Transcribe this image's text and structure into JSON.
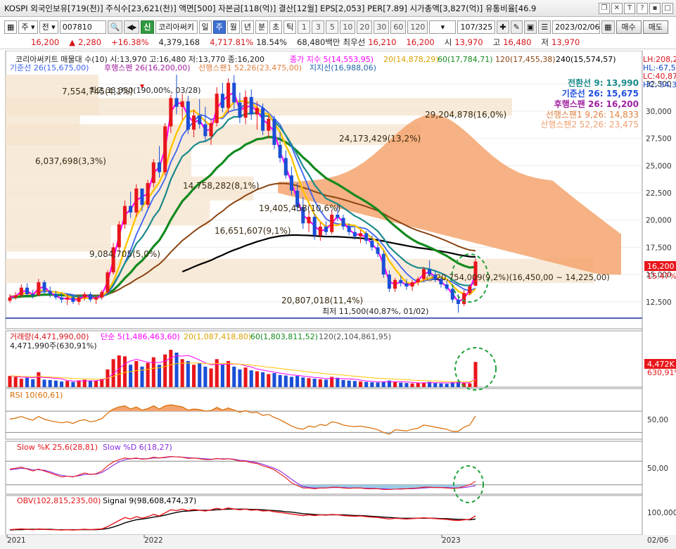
{
  "window": {
    "title": "KOSPI 외국인보유[719(천)] 주식수[23,621(천)] 액면[500] 자본금[118(억)] 결산[12월] EPS[2,053] PER[7.89] 시가총액[3,827(억)] 유통비율[46.9",
    "icons": [
      "restore-icon",
      "close-icon"
    ],
    "icon_glyphs": [
      "T",
      "?",
      "▪",
      "□"
    ]
  },
  "toolbar": {
    "period_select": "주",
    "adj_select": "전",
    "code": "007810",
    "stock_badge": "신",
    "stock_name": "코리아써키",
    "timeframes": [
      "일",
      "주",
      "월",
      "년",
      "분",
      "초",
      "틱"
    ],
    "active_timeframe": "주",
    "intervals": [
      "1",
      "3",
      "5",
      "10",
      "20",
      "30",
      "60",
      "120"
    ],
    "page_count": "107/325",
    "date": "2023/02/06",
    "buy_label": "매수",
    "sell_label": "매도"
  },
  "price_row": {
    "price": "16,200",
    "change_arrow": "▲",
    "change": "2,280",
    "change_rate": "+16.38%",
    "volume": "4,379,168",
    "volume_rate": "4,717.81%",
    "turnover": "18.54%",
    "amount": "68,480백만",
    "priority_label": "최우선",
    "priority": "16,210",
    "bid": "16,200",
    "open_label": "시",
    "open": "13,970",
    "high_label": "고",
    "high": "16,480",
    "low_label": "저",
    "low": "13,970"
  },
  "price_panel": {
    "header": "코리아써키트 매물대 수(10)   시:13,970 고:16,480 저:13,770 종:16,200",
    "ma_legend": [
      {
        "label": "종가 지수 5(14,553,95)",
        "color": "#ff00ff"
      },
      {
        "label": "20(14,878,29)",
        "color": "#ffc400"
      },
      {
        "label": "60(17,784,71)",
        "color": "#138a1e"
      },
      {
        "label": "120(17,455,38)",
        "color": "#8b4513"
      },
      {
        "label": "240(15,574,57)",
        "color": "#000000"
      }
    ],
    "ichimoku_row2": "기준선 26(15,675,00)",
    "ichimoku_row2b": "후행스팬 26(16,200,00)",
    "ichimoku_row2c": "선행스팬1 52,26(23,475,00)",
    "ichimoku_row2d": "지지선(16,988,06)",
    "right_legend": [
      {
        "label": "전환선 9: 13,990",
        "color": "#1a8a8a"
      },
      {
        "label": "기준선 26: 15,675",
        "color": "#1f4fe0"
      },
      {
        "label": "후행스팬 26: 16,200",
        "color": "#a020a0"
      },
      {
        "label": "선행스팬1 9,26: 14,833",
        "color": "#e08040"
      },
      {
        "label": "선행스팬2 52,26: 23,475",
        "color": "#f0a070"
      }
    ],
    "hl_labels": [
      "LH:208,2",
      "HL:-67,5",
      "LC:40,87",
      "HC:-54,3"
    ],
    "price_tag": "16,200",
    "price_tag_pct": "15.47%",
    "y_ticks": [
      "32,500",
      "30,000",
      "27,500",
      "25,000",
      "22,500",
      "20,000",
      "17,500",
      "15,000",
      "12,500"
    ],
    "max_label": "최고 33,350(190,00%, 03/28)",
    "min_label": "최저 11,500(40,87%, 01/02)",
    "volume_profile": [
      "7,554,745(4,1%)",
      "6,037,698(3,3%)",
      "14,758,282(8,1%)",
      "19,405,458(10,6%)",
      "16,651,607(9,1%)",
      "9,084,705(5,0%)",
      "29,204,878(16,0%)",
      "24,173,429(13,2%)",
      "20,807,018(11,4%)"
    ],
    "current_band": "○ 20,754,009(9,2%)(16,450,00 ~ 14,225,00)"
  },
  "volume_panel": {
    "header": "거래량(4,471,990,00)",
    "ma_legend": [
      {
        "label": "단순 5(1,486,463,60)",
        "color": "#ff00ff"
      },
      {
        "label": "20(1,087,418,80)",
        "color": "#ffc400"
      },
      {
        "label": "60(1,803,811,52)",
        "color": "#138a1e"
      },
      {
        "label": "120(2,104,861,95)",
        "color": "#555555"
      }
    ],
    "sub": "4,471,990주(630,91%)",
    "tag": "4,472K",
    "tag_pct": "630,91%"
  },
  "rsi_panel": {
    "header": "RSI 10(60,61)",
    "y_tick": "50,00"
  },
  "stoch_panel": {
    "header_k": "Slow %K 25,6(28,81)",
    "header_d": "Slow %D 6(18,27)",
    "y_tick": "50,00"
  },
  "obv_panel": {
    "header_obv": "OBV(102,815,235,00)",
    "header_signal": "Signal 9(98,608,474,37)",
    "y_tick": "100,000"
  },
  "x_axis": {
    "labels": [
      "2021",
      "2022",
      "2023",
      "02/06"
    ]
  },
  "colors": {
    "up": "#e8161b",
    "down": "#1a4fd6",
    "ma5": "#ff00ff",
    "ma20": "#ffc400",
    "ma60": "#138a1e",
    "ma120": "#8b4513",
    "ma240": "#000000",
    "tenkan": "#1a8a8a",
    "kijun": "#3b63f0",
    "cloud": "#f4a56f",
    "profile": "#f6e3cc",
    "highlight_circle": "#1fa13b"
  },
  "chart_data": {
    "type": "candlestick",
    "title": "코리아써키트",
    "x_range": [
      "2020-12",
      "2023-02-06"
    ],
    "ylim": [
      11000,
      34000
    ],
    "candles": [
      [
        12600,
        13200,
        12400,
        12900
      ],
      [
        12900,
        13400,
        12700,
        13100
      ],
      [
        13100,
        14100,
        12900,
        13800
      ],
      [
        13800,
        14200,
        13000,
        13200
      ],
      [
        13200,
        13600,
        12800,
        13100
      ],
      [
        13100,
        14600,
        13000,
        14300
      ],
      [
        14300,
        14500,
        13200,
        13500
      ],
      [
        13500,
        13900,
        12900,
        13200
      ],
      [
        13200,
        13500,
        12700,
        12900
      ],
      [
        12900,
        13300,
        12400,
        12700
      ],
      [
        12700,
        13200,
        12200,
        12900
      ],
      [
        12900,
        13100,
        12300,
        12500
      ],
      [
        12500,
        13100,
        12200,
        12900
      ],
      [
        12900,
        13400,
        12600,
        13200
      ],
      [
        13200,
        13400,
        12500,
        12700
      ],
      [
        12700,
        13100,
        12300,
        12900
      ],
      [
        12900,
        13600,
        12700,
        13400
      ],
      [
        13400,
        15400,
        13200,
        15200
      ],
      [
        15200,
        17900,
        15000,
        17500
      ],
      [
        17500,
        19900,
        17100,
        19600
      ],
      [
        19600,
        21800,
        19200,
        21300
      ],
      [
        21300,
        22600,
        20200,
        20700
      ],
      [
        20700,
        23300,
        20300,
        22900
      ],
      [
        22900,
        22800,
        20800,
        21400
      ],
      [
        21400,
        23700,
        21100,
        23400
      ],
      [
        23400,
        25600,
        23000,
        25300
      ],
      [
        25300,
        26800,
        23900,
        24400
      ],
      [
        24400,
        28900,
        24100,
        28600
      ],
      [
        28600,
        31500,
        28000,
        31200
      ],
      [
        31200,
        33350,
        29700,
        30400
      ],
      [
        30400,
        31600,
        29200,
        30900
      ],
      [
        30900,
        31400,
        27900,
        28300
      ],
      [
        28300,
        30100,
        27600,
        29600
      ],
      [
        29600,
        31100,
        28400,
        28800
      ],
      [
        28800,
        30400,
        27200,
        27700
      ],
      [
        27700,
        29300,
        26900,
        28900
      ],
      [
        28900,
        32200,
        28600,
        31600
      ],
      [
        31600,
        32600,
        29900,
        30300
      ],
      [
        30300,
        33000,
        29800,
        32600
      ],
      [
        32600,
        33300,
        30200,
        30800
      ],
      [
        30800,
        31700,
        28900,
        29400
      ],
      [
        29400,
        31900,
        28800,
        31300
      ],
      [
        31300,
        32000,
        29200,
        29700
      ],
      [
        29700,
        30900,
        28300,
        30300
      ],
      [
        30300,
        30700,
        27800,
        28200
      ],
      [
        28200,
        29700,
        27500,
        29300
      ],
      [
        29300,
        29600,
        26500,
        26900
      ],
      [
        26900,
        28100,
        25300,
        25700
      ],
      [
        25700,
        26400,
        23800,
        24100
      ],
      [
        24100,
        24900,
        22300,
        22700
      ],
      [
        22700,
        23400,
        20800,
        21200
      ],
      [
        21200,
        22100,
        19200,
        19700
      ],
      [
        19700,
        20800,
        18900,
        20300
      ],
      [
        20300,
        20600,
        18200,
        18600
      ],
      [
        18600,
        19800,
        18100,
        19400
      ],
      [
        19400,
        19900,
        18600,
        18900
      ],
      [
        18900,
        20900,
        18700,
        20500
      ],
      [
        20500,
        21400,
        19900,
        20200
      ],
      [
        20200,
        20500,
        19100,
        19400
      ],
      [
        19400,
        19700,
        18600,
        18900
      ],
      [
        18900,
        19300,
        18200,
        18500
      ],
      [
        18500,
        19100,
        17900,
        18800
      ],
      [
        18800,
        19000,
        17800,
        18100
      ],
      [
        18100,
        18600,
        17200,
        17500
      ],
      [
        17500,
        17900,
        16600,
        16900
      ],
      [
        16900,
        17200,
        14700,
        15000
      ],
      [
        15000,
        15400,
        13400,
        13700
      ],
      [
        13700,
        14700,
        13400,
        14500
      ],
      [
        14500,
        14900,
        13900,
        14200
      ],
      [
        14200,
        14600,
        13600,
        13900
      ],
      [
        13900,
        14500,
        13500,
        14300
      ],
      [
        14300,
        14800,
        14000,
        14600
      ],
      [
        14600,
        15700,
        14400,
        15500
      ],
      [
        15500,
        16300,
        14800,
        15000
      ],
      [
        15000,
        15400,
        14300,
        14500
      ],
      [
        14500,
        14800,
        13800,
        14100
      ],
      [
        14100,
        14400,
        13500,
        13700
      ],
      [
        13700,
        14000,
        12400,
        12700
      ],
      [
        12700,
        13200,
        11500,
        12300
      ],
      [
        12300,
        13600,
        12100,
        13300
      ],
      [
        13300,
        14100,
        13100,
        13900
      ],
      [
        13970,
        16480,
        13970,
        16200
      ]
    ],
    "ma_series": [
      {
        "name": "5",
        "color": "#ff00ff"
      },
      {
        "name": "20",
        "color": "#ffc400"
      },
      {
        "name": "60",
        "color": "#138a1e"
      },
      {
        "name": "120",
        "color": "#8b4513"
      },
      {
        "name": "240",
        "color": "#000000"
      }
    ],
    "volume": [
      60,
      55,
      45,
      50,
      42,
      80,
      40,
      38,
      35,
      30,
      33,
      28,
      36,
      40,
      32,
      35,
      45,
      95,
      150,
      170,
      165,
      120,
      140,
      110,
      130,
      160,
      120,
      175,
      200,
      185,
      150,
      140,
      120,
      130,
      110,
      100,
      150,
      120,
      140,
      110,
      95,
      105,
      90,
      85,
      80,
      70,
      75,
      65,
      62,
      55,
      60,
      52,
      48,
      45,
      42,
      40,
      55,
      50,
      38,
      35,
      33,
      30,
      28,
      26,
      25,
      30,
      35,
      28,
      24,
      22,
      20,
      22,
      25,
      28,
      22,
      20,
      18,
      26,
      30,
      22,
      20,
      135
    ],
    "rsi": [
      55,
      57,
      60,
      56,
      53,
      60,
      55,
      52,
      50,
      48,
      50,
      47,
      52,
      54,
      50,
      52,
      56,
      66,
      74,
      78,
      80,
      74,
      78,
      72,
      75,
      80,
      74,
      80,
      82,
      80,
      78,
      72,
      74,
      73,
      70,
      71,
      77,
      72,
      76,
      72,
      68,
      71,
      67,
      68,
      62,
      64,
      58,
      54,
      48,
      42,
      38,
      36,
      42,
      40,
      45,
      43,
      50,
      48,
      44,
      42,
      41,
      42,
      40,
      38,
      35,
      30,
      27,
      35,
      34,
      33,
      36,
      38,
      44,
      42,
      40,
      38,
      36,
      32,
      32,
      40,
      44,
      61
    ],
    "stoch_k": [
      60,
      62,
      65,
      60,
      55,
      60,
      55,
      50,
      45,
      40,
      42,
      40,
      45,
      50,
      46,
      48,
      55,
      68,
      78,
      84,
      88,
      86,
      88,
      85,
      86,
      90,
      88,
      90,
      92,
      91,
      90,
      87,
      88,
      86,
      84,
      84,
      87,
      85,
      86,
      84,
      80,
      80,
      76,
      74,
      68,
      64,
      58,
      48,
      38,
      25,
      18,
      12,
      12,
      10,
      12,
      12,
      14,
      14,
      12,
      11,
      12,
      12,
      10,
      10,
      10,
      8,
      8,
      9,
      10,
      10,
      11,
      12,
      14,
      14,
      13,
      13,
      12,
      11,
      12,
      16,
      20,
      29
    ],
    "stoch_d": [
      58,
      60,
      62,
      61,
      58,
      58,
      57,
      53,
      48,
      44,
      42,
      41,
      43,
      46,
      47,
      47,
      51,
      60,
      70,
      78,
      84,
      86,
      87,
      86,
      86,
      88,
      88,
      89,
      91,
      91,
      90,
      89,
      88,
      87,
      86,
      85,
      86,
      86,
      86,
      85,
      82,
      81,
      79,
      76,
      72,
      67,
      62,
      55,
      45,
      34,
      24,
      16,
      13,
      12,
      12,
      12,
      13,
      13,
      13,
      12,
      12,
      12,
      11,
      11,
      10,
      10,
      9,
      9,
      9,
      10,
      10,
      11,
      12,
      13,
      13,
      13,
      13,
      12,
      12,
      13,
      15,
      18
    ],
    "obv": [
      10,
      11,
      12,
      11,
      10,
      12,
      11,
      10,
      10,
      9,
      10,
      9,
      10,
      11,
      10,
      11,
      12,
      18,
      26,
      34,
      42,
      38,
      44,
      40,
      44,
      50,
      46,
      54,
      62,
      60,
      64,
      60,
      63,
      61,
      59,
      62,
      66,
      63,
      67,
      64,
      62,
      64,
      61,
      62,
      59,
      60,
      57,
      55,
      53,
      51,
      49,
      47,
      49,
      47,
      49,
      48,
      50,
      49,
      47,
      46,
      45,
      46,
      44,
      43,
      42,
      40,
      38,
      40,
      39,
      38,
      39,
      40,
      41,
      40,
      39,
      38,
      37,
      35,
      34,
      36,
      37,
      46
    ],
    "obv_signal": [
      9,
      10,
      10,
      11,
      11,
      11,
      11,
      11,
      10,
      10,
      10,
      10,
      10,
      10,
      10,
      10,
      11,
      13,
      17,
      22,
      28,
      32,
      36,
      38,
      40,
      43,
      45,
      48,
      52,
      55,
      58,
      59,
      60,
      61,
      61,
      61,
      62,
      63,
      64,
      64,
      64,
      64,
      63,
      63,
      62,
      61,
      60,
      59,
      57,
      56,
      54,
      52,
      51,
      50,
      49,
      49,
      49,
      49,
      49,
      48,
      47,
      47,
      46,
      45,
      44,
      43,
      42,
      41,
      40,
      40,
      40,
      40,
      40,
      40,
      40,
      39,
      39,
      38,
      37,
      37,
      36,
      38
    ]
  }
}
